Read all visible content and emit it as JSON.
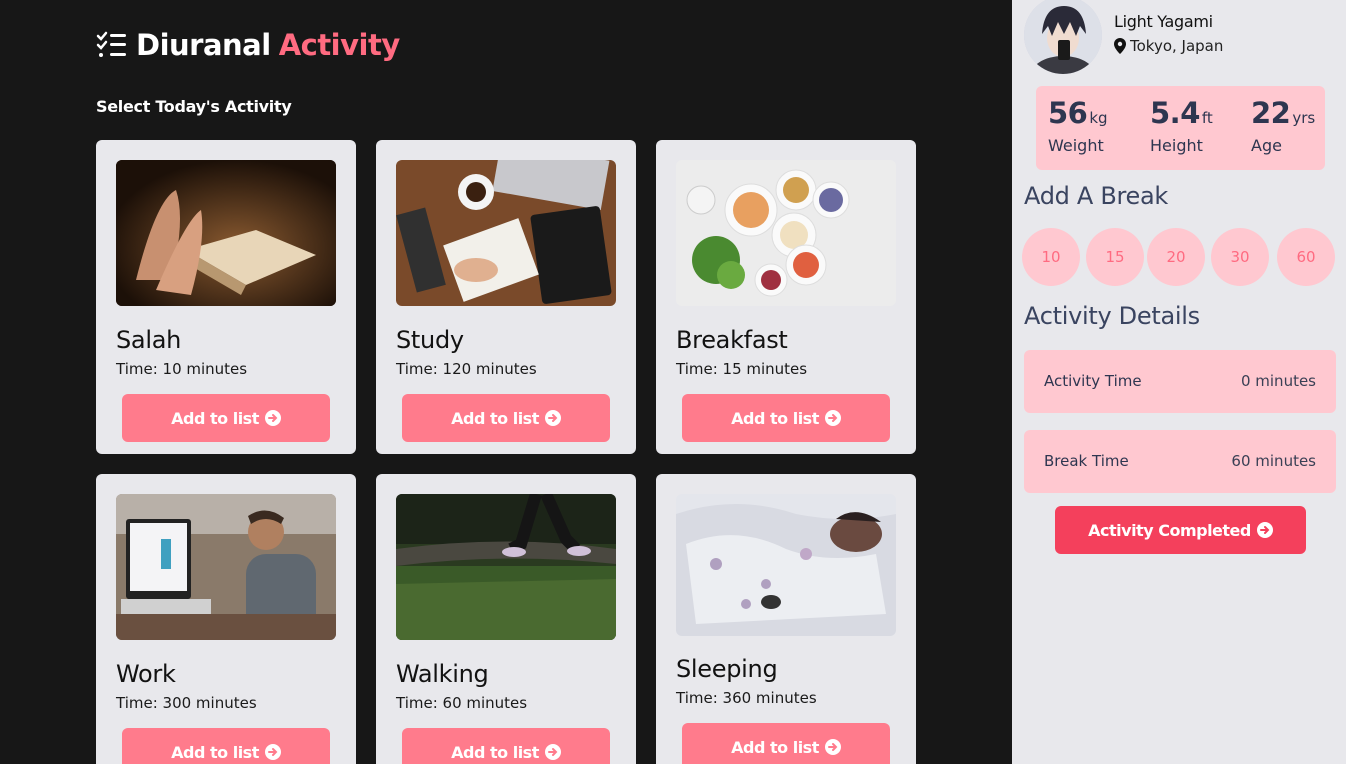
{
  "brand": {
    "name": "Diuranal",
    "accent": "Activity"
  },
  "subtitle": "Select Today's Activity",
  "activities": [
    {
      "title": "Salah",
      "time": "Time: 10 minutes",
      "button": "Add to list"
    },
    {
      "title": "Study",
      "time": "Time: 120 minutes",
      "button": "Add to list"
    },
    {
      "title": "Breakfast",
      "time": "Time: 15 minutes",
      "button": "Add to list"
    },
    {
      "title": "Work",
      "time": "Time: 300 minutes",
      "button": "Add to list"
    },
    {
      "title": "Walking",
      "time": "Time: 60 minutes",
      "button": "Add to list"
    },
    {
      "title": "Sleeping",
      "time": "Time: 360 minutes",
      "button": "Add to list"
    }
  ],
  "profile": {
    "name": "Light Yagami",
    "location": "Tokyo, Japan",
    "stats": [
      {
        "value": "56",
        "unit": "kg",
        "label": "Weight"
      },
      {
        "value": "5.4",
        "unit": "ft",
        "label": "Height"
      },
      {
        "value": "22",
        "unit": "yrs",
        "label": "Age"
      }
    ]
  },
  "break_section": {
    "title": "Add A Break",
    "options": [
      "10",
      "15",
      "20",
      "30",
      "60"
    ]
  },
  "details_section": {
    "title": "Activity Details",
    "activity_time_label": "Activity Time",
    "activity_time_value": "0 minutes",
    "break_time_label": "Break Time",
    "break_time_value": "60 minutes"
  },
  "complete_button": "Activity Completed",
  "colors": {
    "accent": "#ff6b81",
    "button": "#ff7b8c",
    "complete": "#f4405c",
    "panel": "#ffc8d0",
    "sidebar": "#e8e8ec",
    "background": "#171717"
  },
  "icons": {
    "brand": "checklist-icon",
    "location": "map-pin-icon",
    "button": "arrow-circle-right-icon"
  }
}
